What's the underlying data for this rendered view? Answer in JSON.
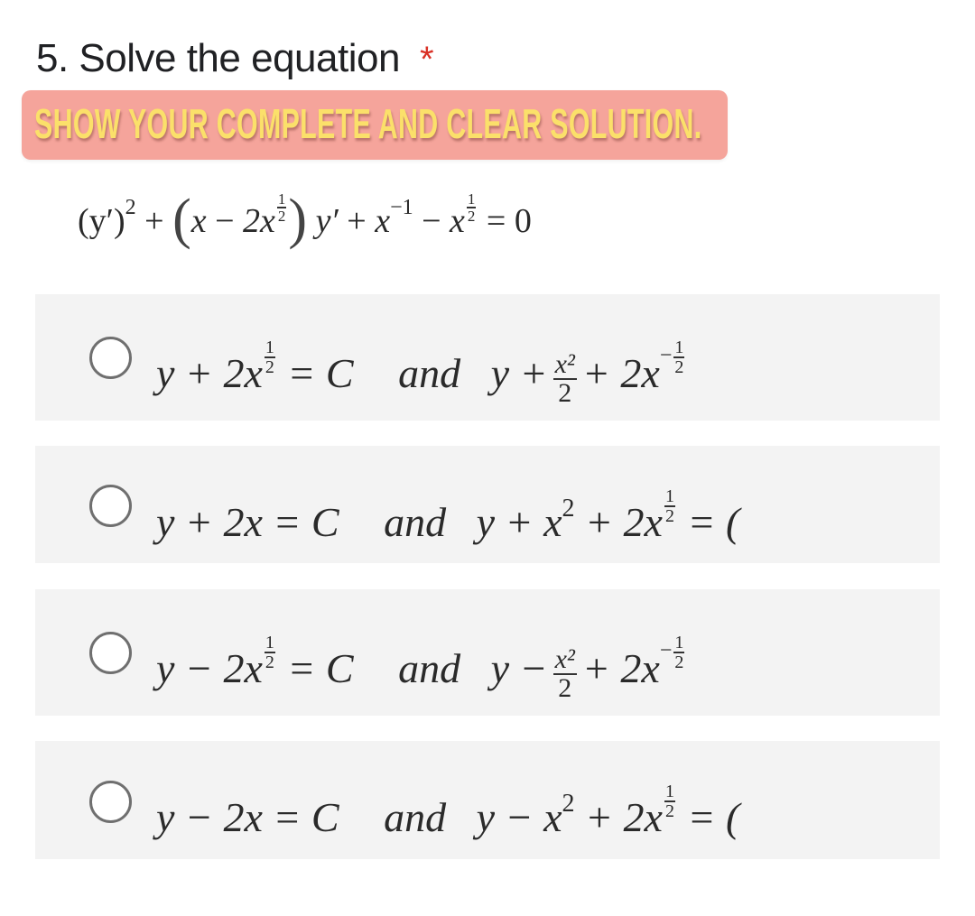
{
  "question": {
    "number_title": "5. Solve the equation",
    "required_marker": "*",
    "instruction_banner": "SHOW YOUR COMPLETE AND CLEAR SOLUTION.",
    "equation": {
      "lhs_a": "(y′)",
      "sq": "2",
      "plus1": "+",
      "lparen": "(",
      "x": "x",
      "minus": "−",
      "two_x": "2x",
      "half_num": "1",
      "half_den": "2",
      "rparen": ")",
      "y_prime": "y′",
      "plus2": "+",
      "x2": "x",
      "neg_one": "−1",
      "minus2": "−",
      "x3": "x",
      "equals": "= 0"
    }
  },
  "options": [
    {
      "id": "a",
      "left": "y + 2x",
      "left_exp_num": "1",
      "left_exp_den": "2",
      "left_rhs": "= C",
      "and": "and",
      "right_start": "y +",
      "frac_num": "x²",
      "frac_den": "2",
      "right_mid": "+ 2x",
      "right_exp_sign": "−",
      "right_exp_num": "1",
      "right_exp_den": "2"
    },
    {
      "id": "b",
      "left": "y + 2x = C",
      "and": "and",
      "right_start": "y + x",
      "sq": "2",
      "right_mid": "+ 2x",
      "right_exp_num": "1",
      "right_exp_den": "2",
      "right_end": "= (",
      "truncated": true
    },
    {
      "id": "c",
      "left": "y − 2x",
      "left_exp_num": "1",
      "left_exp_den": "2",
      "left_rhs": "= C",
      "and": "and",
      "right_start": "y −",
      "frac_num": "x²",
      "frac_den": "2",
      "right_mid": "+ 2x",
      "right_exp_sign": "−",
      "right_exp_num": "1",
      "right_exp_den": "2"
    },
    {
      "id": "d",
      "left": "y − 2x = C",
      "and": "and",
      "right_start": "y − x",
      "sq": "2",
      "right_mid": "+ 2x",
      "right_exp_num": "1",
      "right_exp_den": "2",
      "right_end": "= (",
      "truncated": true
    }
  ],
  "colors": {
    "required": "#d93025",
    "banner_bg": "#f5a49b",
    "banner_text": "#fbe06a",
    "option_bg": "#f3f3f3",
    "radio_border": "#6f6f6f"
  }
}
